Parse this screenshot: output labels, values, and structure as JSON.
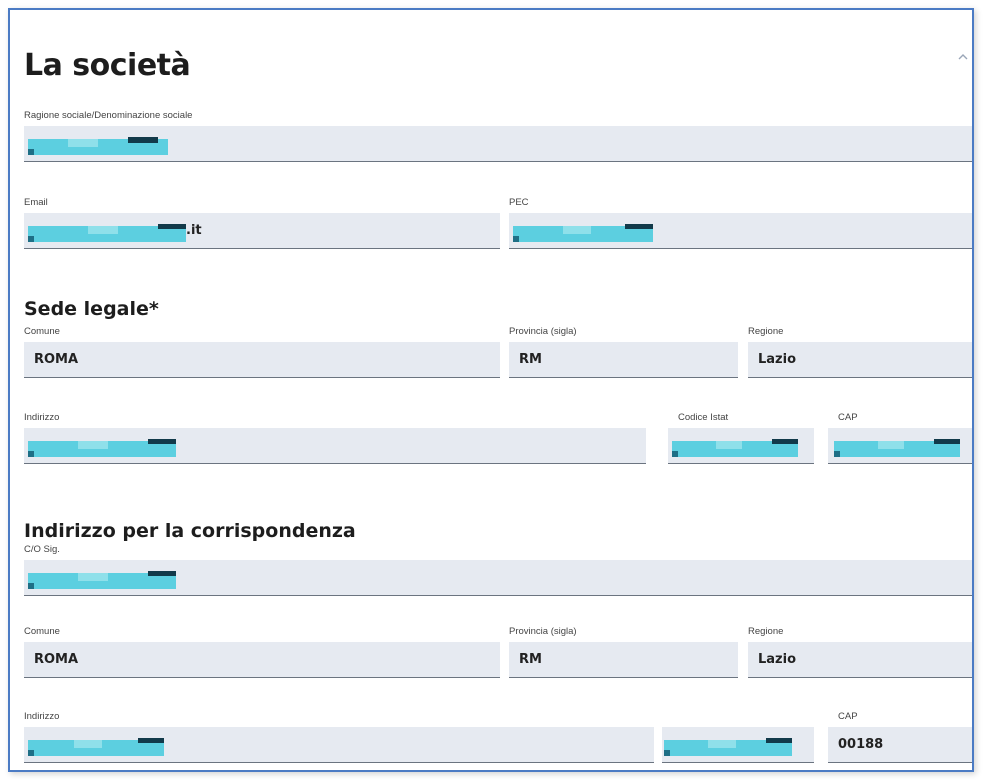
{
  "company": {
    "title": "La società",
    "ragione_sociale": {
      "label": "Ragione sociale/Denominazione sociale",
      "value": ""
    },
    "email": {
      "label": "Email",
      "value_suffix": ".it"
    },
    "pec": {
      "label": "PEC",
      "value": ""
    }
  },
  "sede_legale": {
    "heading": "Sede legale*",
    "comune": {
      "label": "Comune",
      "value": "ROMA"
    },
    "provincia": {
      "label": "Provincia (sigla)",
      "value": "RM"
    },
    "regione": {
      "label": "Regione",
      "value": "Lazio"
    },
    "indirizzo": {
      "label": "Indirizzo",
      "value": ""
    },
    "codice_istat": {
      "label": "Codice Istat",
      "value": ""
    },
    "cap": {
      "label": "CAP",
      "value": ""
    }
  },
  "corrispondenza": {
    "heading": "Indirizzo per la corrispondenza",
    "co": {
      "label": "C/O Sig.",
      "value": ""
    },
    "comune": {
      "label": "Comune",
      "value": "ROMA"
    },
    "provincia": {
      "label": "Provincia (sigla)",
      "value": "RM"
    },
    "regione": {
      "label": "Regione",
      "value": "Lazio"
    },
    "indirizzo": {
      "label": "Indirizzo",
      "value": ""
    },
    "civico": {
      "value": ""
    },
    "cap": {
      "label": "CAP",
      "value": "00188"
    }
  },
  "icons": {
    "collapse": "chevron-up-icon"
  },
  "colors": {
    "frame": "#4b7bc4",
    "field_bg": "#e6eaf1",
    "redaction": "#5ccfe0"
  }
}
